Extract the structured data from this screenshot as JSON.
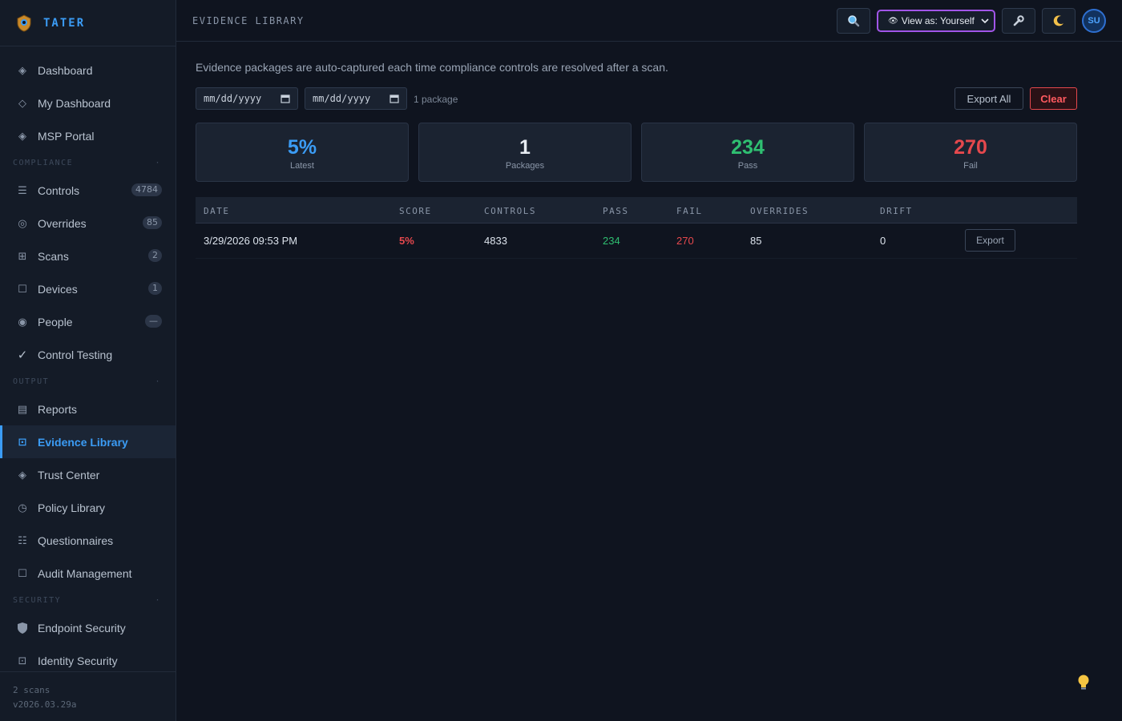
{
  "app": {
    "name": "TATER"
  },
  "sidebar": {
    "items_top": [
      {
        "label": "Dashboard",
        "icon": "diamond-icon"
      },
      {
        "label": "My Dashboard",
        "icon": "diamond-outline-icon"
      },
      {
        "label": "MSP Portal",
        "icon": "diamond-icon"
      }
    ],
    "sections": {
      "compliance": "COMPLIANCE",
      "output": "OUTPUT",
      "security": "SECURITY"
    },
    "compliance_items": [
      {
        "label": "Controls",
        "badge": "4784",
        "icon": "list-icon"
      },
      {
        "label": "Overrides",
        "badge": "85",
        "icon": "target-icon"
      },
      {
        "label": "Scans",
        "badge": "2",
        "icon": "grid-icon"
      },
      {
        "label": "Devices",
        "badge": "1",
        "icon": "square-icon"
      },
      {
        "label": "People",
        "badge": "—",
        "icon": "person-icon"
      },
      {
        "label": "Control Testing",
        "icon": "check-icon"
      }
    ],
    "output_items": [
      {
        "label": "Reports",
        "icon": "report-icon"
      },
      {
        "label": "Evidence Library",
        "icon": "evidence-icon"
      },
      {
        "label": "Trust Center",
        "icon": "diamond-icon"
      },
      {
        "label": "Policy Library",
        "icon": "clock-icon"
      },
      {
        "label": "Questionnaires",
        "icon": "checklist-icon"
      },
      {
        "label": "Audit Management",
        "icon": "square-icon"
      }
    ],
    "security_items": [
      {
        "label": "Endpoint Security",
        "icon": "shield-icon"
      },
      {
        "label": "Identity Security",
        "icon": "id-icon"
      }
    ],
    "footer": {
      "scans": "2 scans",
      "version": "v2026.03.29a"
    }
  },
  "header": {
    "title": "EVIDENCE LIBRARY",
    "view_as": "View as: Yourself",
    "avatar": "SU"
  },
  "main": {
    "description": "Evidence packages are auto-captured each time compliance controls are resolved after a scan.",
    "date_from_placeholder": "mm/dd/yyyy",
    "date_to_placeholder": "mm/dd/yyyy",
    "package_count": "1 package",
    "export_all": "Export All",
    "clear": "Clear",
    "cards": [
      {
        "value": "5%",
        "label": "Latest",
        "color": "#3b9cf5"
      },
      {
        "value": "1",
        "label": "Packages",
        "color": "#e6ebf2"
      },
      {
        "value": "234",
        "label": "Pass",
        "color": "#2fbf71"
      },
      {
        "value": "270",
        "label": "Fail",
        "color": "#e5484d"
      }
    ],
    "table": {
      "headers": [
        "DATE",
        "SCORE",
        "CONTROLS",
        "PASS",
        "FAIL",
        "OVERRIDES",
        "DRIFT"
      ],
      "rows": [
        {
          "date": "3/29/2026 09:53 PM",
          "score": "5%",
          "controls": "4833",
          "pass": "234",
          "fail": "270",
          "overrides": "85",
          "drift": "0",
          "action": "Export"
        }
      ]
    }
  },
  "colors": {
    "accent": "#3b9cf5",
    "pass": "#2fbf71",
    "fail": "#e5484d",
    "purple": "#a155e8"
  }
}
